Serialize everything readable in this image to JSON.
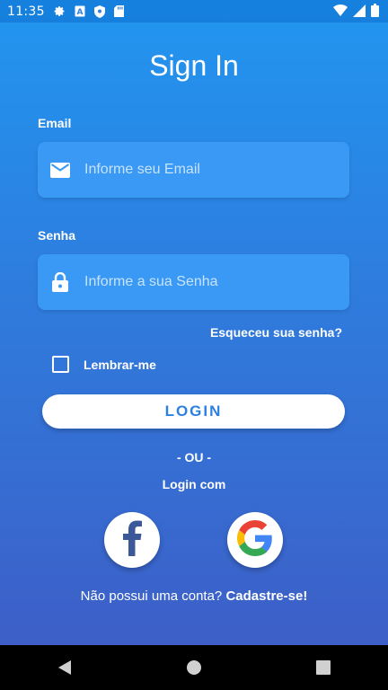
{
  "status_bar": {
    "time": "11:35",
    "left_icons": [
      "gear-icon",
      "a-icon",
      "shield-icon",
      "sd-card-icon"
    ],
    "right_icons": [
      "wifi-icon",
      "signal-icon",
      "battery-icon"
    ]
  },
  "title": "Sign In",
  "email": {
    "label": "Email",
    "placeholder": "Informe seu Email",
    "icon": "mail-icon"
  },
  "password": {
    "label": "Senha",
    "placeholder": "Informe a sua Senha",
    "icon": "lock-icon"
  },
  "forgot_password": "Esqueceu sua senha?",
  "remember_me": {
    "label": "Lembrar-me",
    "checked": false
  },
  "login_button": "LOGIN",
  "or_text": "- OU -",
  "login_with": "Login com",
  "social": [
    {
      "name": "facebook",
      "icon": "facebook-icon"
    },
    {
      "name": "google",
      "icon": "google-icon"
    }
  ],
  "signup": {
    "prompt": "Não possui uma conta? ",
    "link": "Cadastre-se!"
  },
  "colors": {
    "gradient_top": "#2196f0",
    "gradient_bottom": "#3d5fc7",
    "field_bg": "#3a99f4",
    "button_text": "#2d7fe0"
  },
  "nav": [
    "back-icon",
    "home-icon",
    "recents-icon"
  ]
}
